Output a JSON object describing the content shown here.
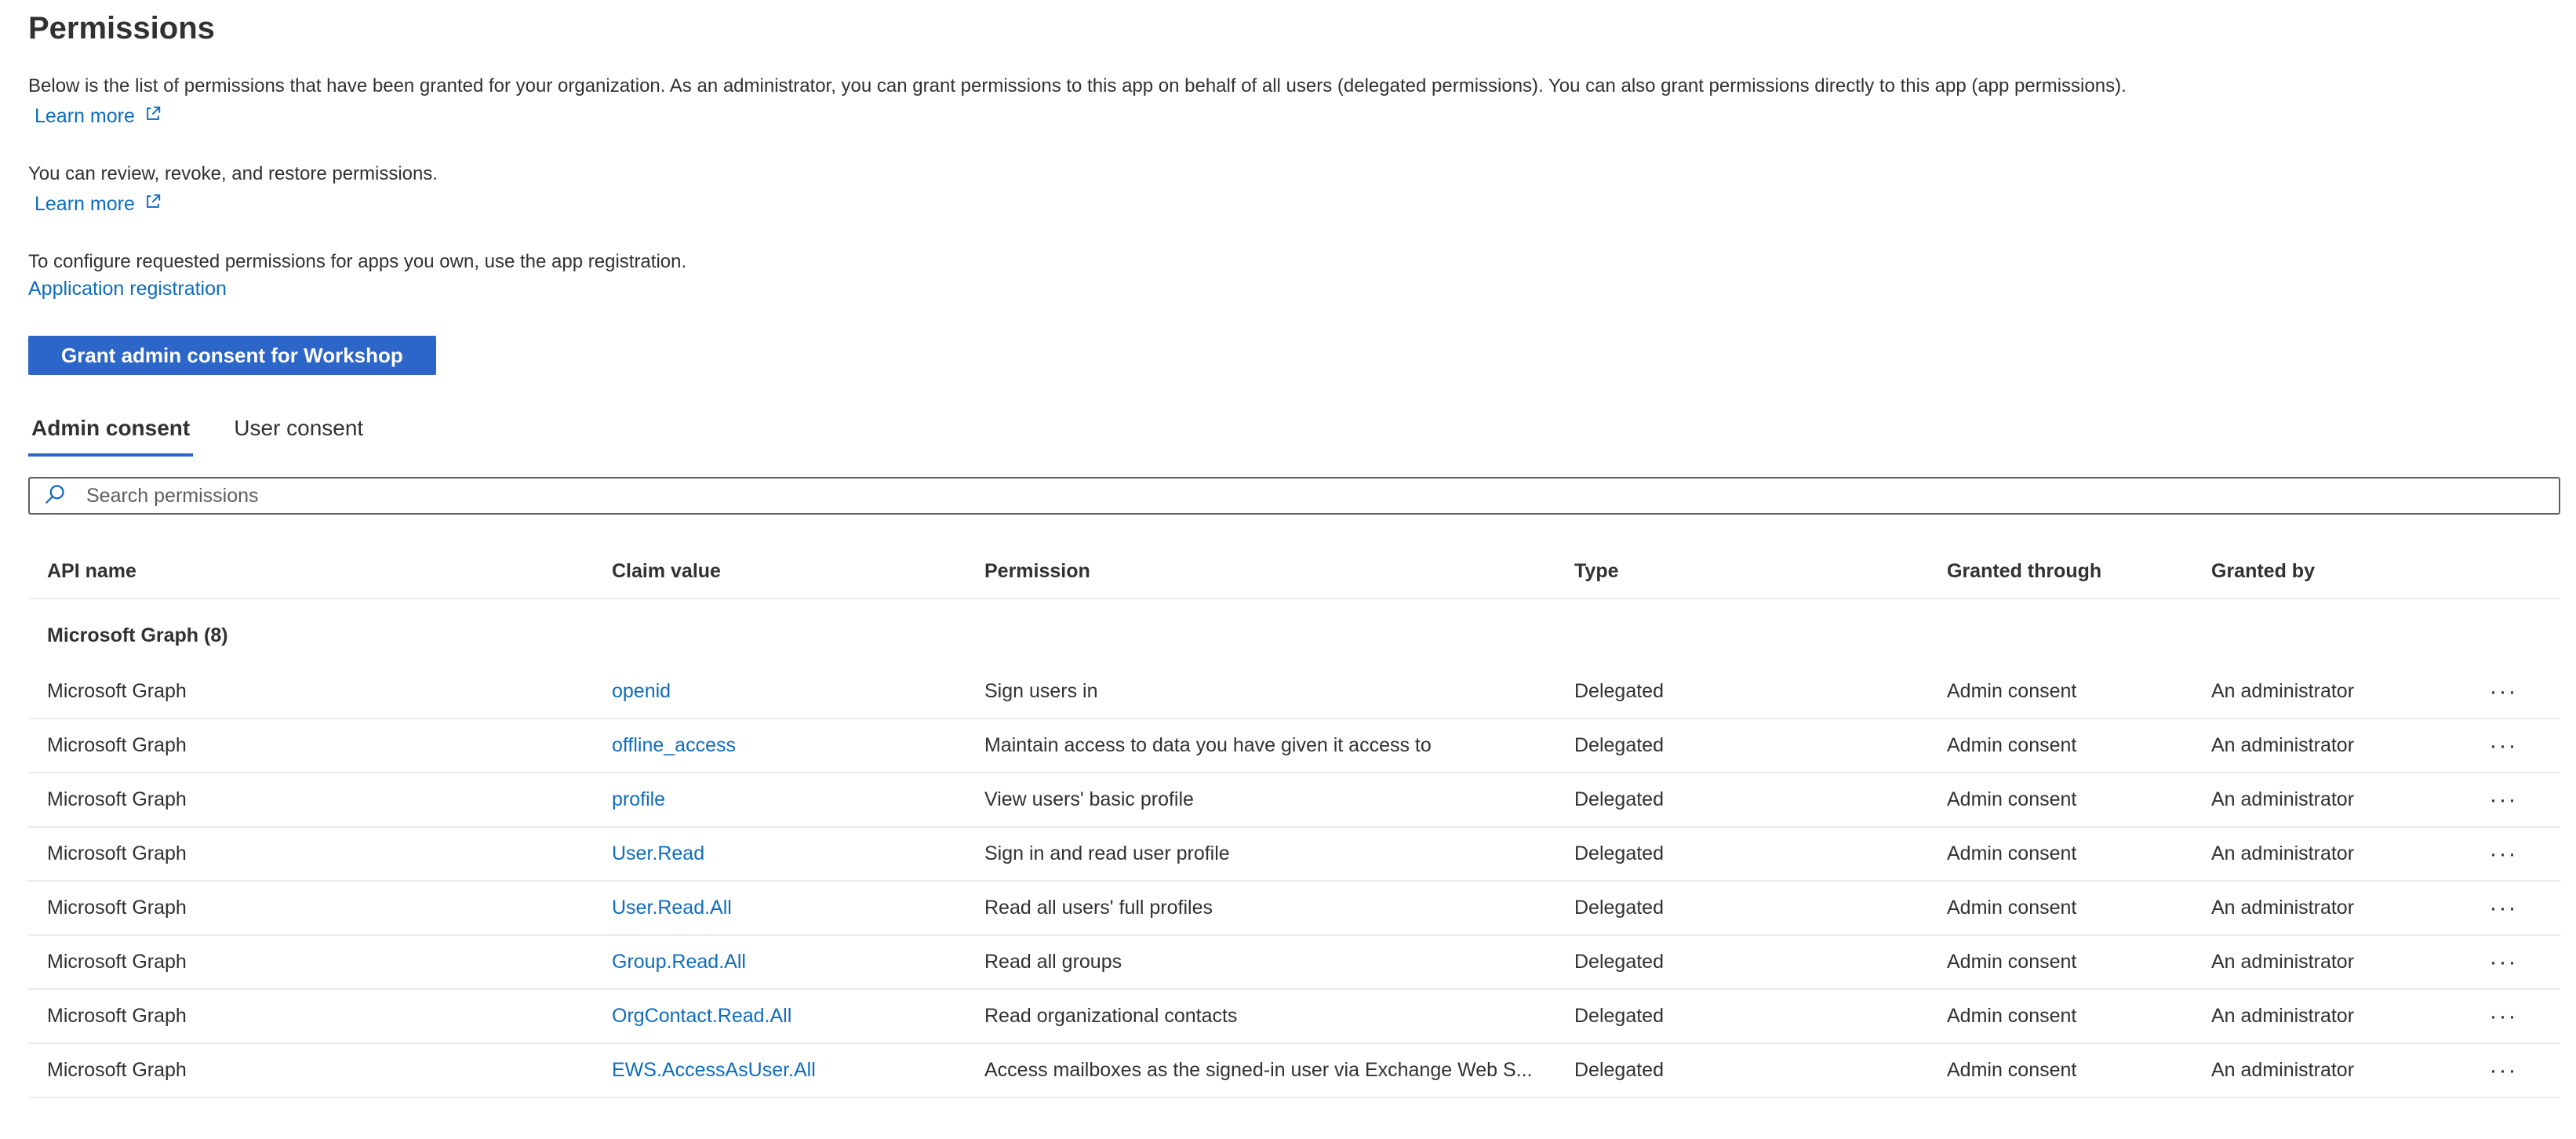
{
  "page": {
    "title": "Permissions",
    "description_1": "Below is the list of permissions that have been granted for your organization. As an administrator, you can grant permissions to this app on behalf of all users (delegated permissions). You can also grant permissions directly to this app (app permissions).",
    "learn_more_1": "Learn more",
    "description_2": "You can review, revoke, and restore permissions.",
    "learn_more_2": "Learn more",
    "description_3": "To configure requested permissions for apps you own, use the app registration.",
    "app_registration_link": "Application registration",
    "grant_button": "Grant admin consent for Workshop"
  },
  "tabs": [
    {
      "label": "Admin consent",
      "active": true
    },
    {
      "label": "User consent",
      "active": false
    }
  ],
  "search": {
    "placeholder": "Search permissions",
    "value": ""
  },
  "table": {
    "columns": [
      "API name",
      "Claim value",
      "Permission",
      "Type",
      "Granted through",
      "Granted by"
    ],
    "group_label": "Microsoft Graph (8)",
    "rows": [
      {
        "api": "Microsoft Graph",
        "claim": "openid",
        "permission": "Sign users in",
        "type": "Delegated",
        "through": "Admin consent",
        "by": "An administrator"
      },
      {
        "api": "Microsoft Graph",
        "claim": "offline_access",
        "permission": "Maintain access to data you have given it access to",
        "type": "Delegated",
        "through": "Admin consent",
        "by": "An administrator"
      },
      {
        "api": "Microsoft Graph",
        "claim": "profile",
        "permission": "View users' basic profile",
        "type": "Delegated",
        "through": "Admin consent",
        "by": "An administrator"
      },
      {
        "api": "Microsoft Graph",
        "claim": "User.Read",
        "permission": "Sign in and read user profile",
        "type": "Delegated",
        "through": "Admin consent",
        "by": "An administrator"
      },
      {
        "api": "Microsoft Graph",
        "claim": "User.Read.All",
        "permission": "Read all users' full profiles",
        "type": "Delegated",
        "through": "Admin consent",
        "by": "An administrator"
      },
      {
        "api": "Microsoft Graph",
        "claim": "Group.Read.All",
        "permission": "Read all groups",
        "type": "Delegated",
        "through": "Admin consent",
        "by": "An administrator"
      },
      {
        "api": "Microsoft Graph",
        "claim": "OrgContact.Read.All",
        "permission": "Read organizational contacts",
        "type": "Delegated",
        "through": "Admin consent",
        "by": "An administrator"
      },
      {
        "api": "Microsoft Graph",
        "claim": "EWS.AccessAsUser.All",
        "permission": "Access mailboxes as the signed-in user via Exchange Web S...",
        "type": "Delegated",
        "through": "Admin consent",
        "by": "An administrator"
      }
    ],
    "more_label": "···"
  },
  "icons": {
    "external_link": "external-link-icon",
    "search": "search-icon",
    "more": "more-icon"
  },
  "colors": {
    "accent": "#2b66c8",
    "link": "#0f6cbd",
    "text": "#323130",
    "divider": "#edebe9"
  }
}
